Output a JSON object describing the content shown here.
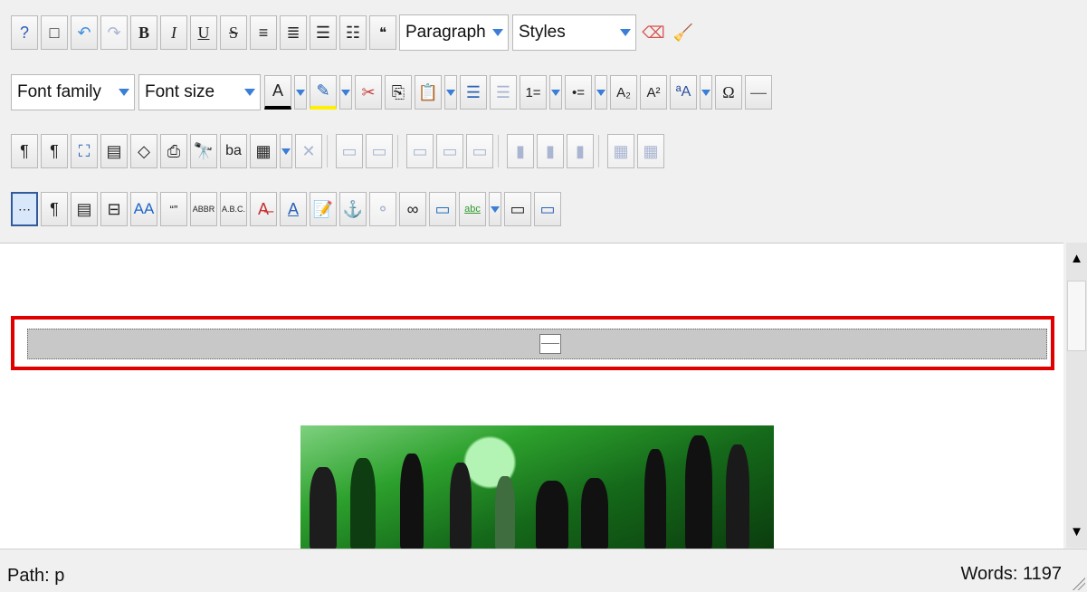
{
  "toolbar": {
    "row1": {
      "format_select": "Paragraph",
      "styles_select": "Styles",
      "buttons": [
        "?",
        "□",
        "↶",
        "↷",
        "B",
        "I",
        "U",
        "S",
        "≡",
        "≣",
        "☰",
        "☷",
        "❝",
        "⌫",
        "🧹"
      ]
    },
    "row2": {
      "font_family": "Font family",
      "font_size": "Font size",
      "buttons": [
        "A",
        "✎",
        "✂",
        "⎘",
        "📋",
        "☰",
        "☰",
        "1=",
        "•=",
        "A₂",
        "A²",
        "ªA",
        "Ω",
        "—"
      ]
    },
    "row3": {
      "buttons": [
        "¶",
        "¶",
        "⛶",
        "▤",
        "◇",
        "⎙",
        "🔭",
        "ba",
        "▦",
        "✕",
        "▭",
        "▭",
        "▭",
        "▭",
        "▭",
        "▮",
        "▮",
        "▮",
        "▦",
        "▦"
      ]
    },
    "row4": {
      "buttons": [
        "⋯",
        "¶",
        "▤",
        "⊟",
        "AA",
        "“”",
        "ABBR",
        "A.B.C.",
        "A̶",
        "A",
        "📝",
        "⚓",
        "⚬",
        "∞",
        "▭",
        "abc",
        "▭",
        "▭"
      ]
    }
  },
  "status": {
    "path": "Path:  p",
    "words": "Words: 1197"
  }
}
